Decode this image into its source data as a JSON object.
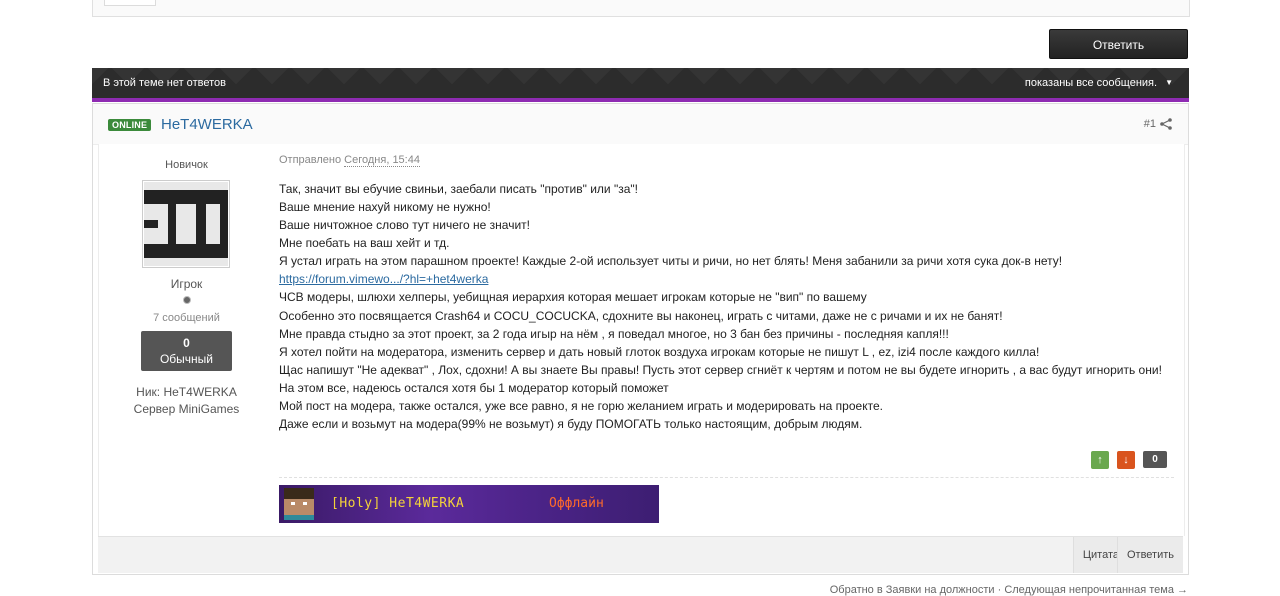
{
  "actions": {
    "reply_button": "Ответить"
  },
  "topic_bar": {
    "no_replies": "В этой теме нет ответов",
    "showing_all": "показаны все сообщения."
  },
  "post": {
    "online_badge": "ONLINE",
    "author": "HeT4WERKA",
    "number": "#1",
    "posted_prefix": "Отправлено",
    "posted_date": "Сегодня, 15:44",
    "author_info": {
      "rank": "Новичок",
      "group": "Игрок",
      "post_count": "7 сообщений",
      "reputation_value": "0",
      "reputation_label": "Обычный",
      "nick_label": "Ник:",
      "nick_value": "HeT4WERKA",
      "server_label": "Сервер",
      "server_value": "MiniGames"
    },
    "lines_before_link": [
      "Так, значит вы ебучие свиньи, заебали писать \"против\" или \"за\"!",
      "Ваше мнение нахуй никому не нужно!",
      "Ваше ничтожное слово тут ничего не значит!",
      "Мне поебать на ваш хейт и тд.",
      "Я устал играть на этом парашном проекте! Каждые 2-ой использует читы и ричи, но нет блять! Меня забанили за ричи хотя сука док-в нету!"
    ],
    "link_text": "https://forum.vimewo.../?hl=+het4werka",
    "lines_after_link": [
      "ЧСВ модеры, шлюхи хелперы, уебищная иерархия которая мешает игрокам которые не \"вип\" по вашему",
      "Особенно это посвящается Crash64 и COCU_COCUCKA, сдохните вы наконец, играть с читами, даже не с ричами и их не банят!",
      "Мне правда стыдно за этот проект, за 2 года игыр на нём , я поведал многое, но 3 бан без причины - последняя капля!!!",
      "Я хотел пойти на модератора, изменить сервер и дать новый глоток воздуха игрокам которые не пишут L , ez, izi4 после каждого килла!",
      "Щас напишут \"Не адекват\" , Лох, сдохни! А вы знаете Вы правы! Пусть этот сервер сгниёт к чертям и потом не вы будете игнорить , а вас будут игнорить они!",
      "На этом все, надеюсь остался хотя бы 1 модератор который поможет",
      "Мой пост на модера, также остался, уже все равно, я не горю желанием играть и модерировать на проекте.",
      "Даже если и возьмут на модера(99% не возьмут) я буду ПОМОГАТЬ только настоящим, добрым людям."
    ],
    "vote_count": "0",
    "signature": {
      "name": "[Holy] HeT4WERKA",
      "status": "Оффлайн"
    },
    "footer": {
      "quote": "Цитата",
      "reply": "Ответить"
    }
  },
  "bottom_nav": {
    "back": "Обратно в Заявки на должности",
    "separator": " · ",
    "next": "Следующая непрочитанная тема →"
  },
  "colors": {
    "accent_purple": "#8e2bb2",
    "online_green": "#3b8a3b",
    "link_blue": "#2b6aa0"
  }
}
